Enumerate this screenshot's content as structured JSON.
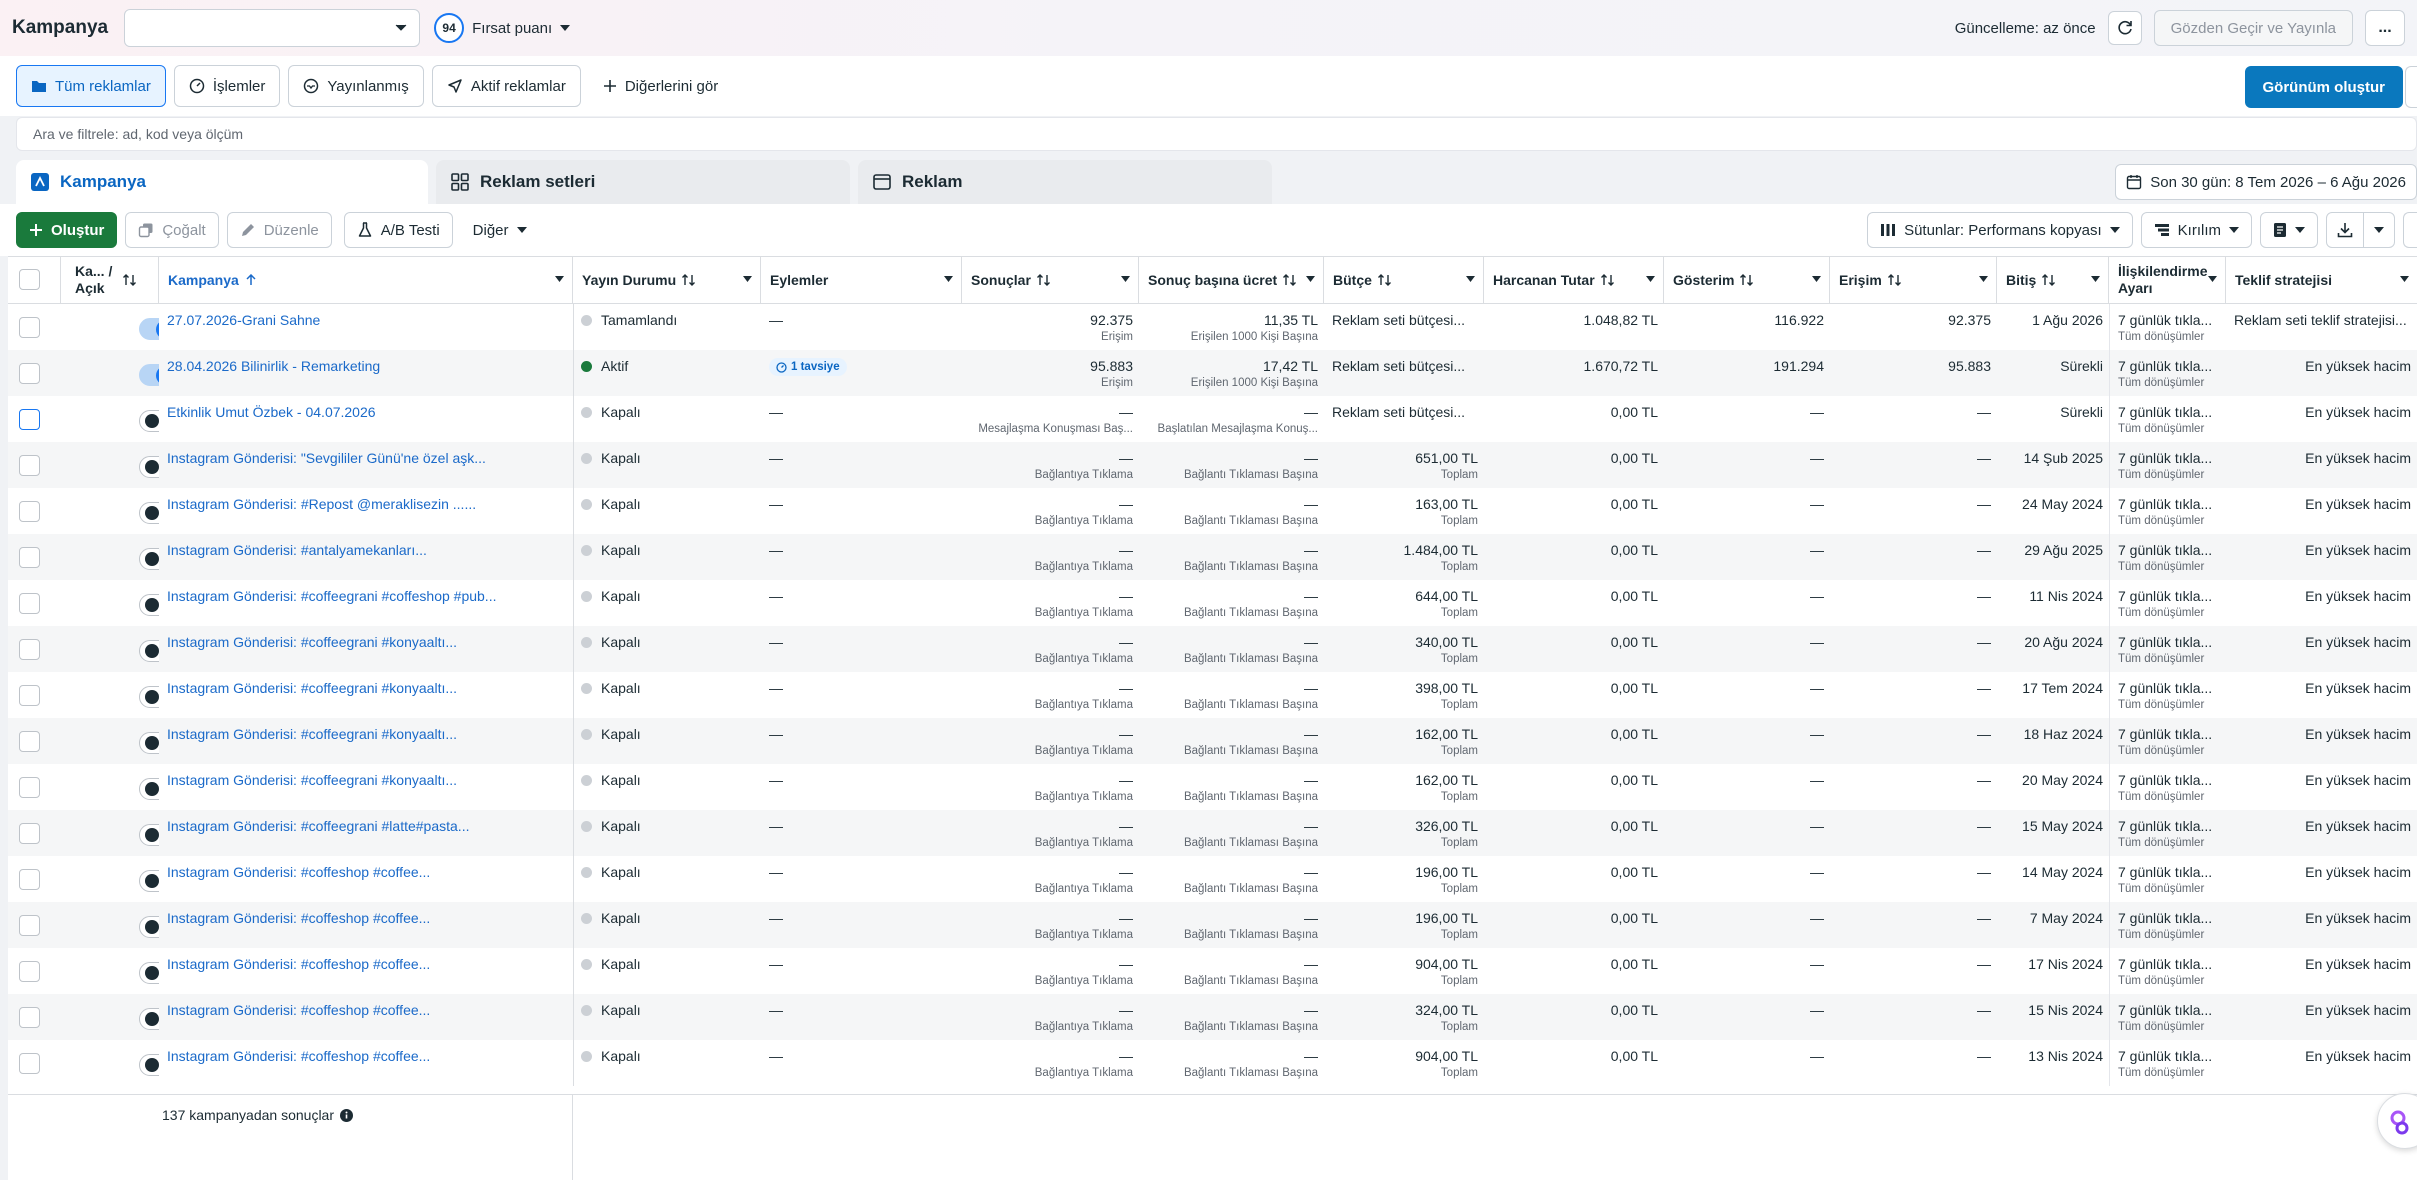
{
  "header": {
    "title": "Kampanya",
    "campaign_select_value": "",
    "score_value": "94",
    "score_label": "Fırsat puanı",
    "updated_text": "Güncelleme: az önce",
    "review_publish_label": "Gözden Geçir ve Yayınla",
    "more_label": "..."
  },
  "views": {
    "items": [
      "Tüm reklamlar",
      "İşlemler",
      "Yayınlanmış",
      "Aktif reklamlar",
      "Diğerlerini gör"
    ],
    "create_view_label": "Görünüm oluştur"
  },
  "search": {
    "placeholder": "Ara ve filtrele: ad, kod veya ölçüm"
  },
  "level_tabs": {
    "campaign": "Kampanya",
    "adsets": "Reklam setleri",
    "ads": "Reklam",
    "date_range": "Son 30 gün: 8 Tem 2026 – 6 Ağu 2026"
  },
  "toolbar": {
    "create": "Oluştur",
    "duplicate": "Çoğalt",
    "edit": "Düzenle",
    "ab_test": "A/B Testi",
    "other": "Diğer",
    "columns": "Sütunlar: Performans kopyası",
    "breakdown": "Kırılım"
  },
  "table": {
    "headers": {
      "toggle": "Ka... / Açık",
      "campaign": "Kampanya",
      "delivery": "Yayın Durumu",
      "actions": "Eylemler",
      "results": "Sonuçlar",
      "cost_per_result": "Sonuç başına ücret",
      "budget": "Bütçe",
      "amount_spent": "Harcanan Tutar",
      "impressions": "Gösterim",
      "reach": "Erişim",
      "ends": "Bitiş",
      "attribution": "İlişkilendirme Ayarı",
      "bid_strategy": "Teklif stratejisi"
    },
    "rows": [
      {
        "on": true,
        "name": "27.07.2026-Grani Sahne",
        "status": "Tamamlandı",
        "status_type": "off",
        "actions": "—",
        "badge": "",
        "results": "92.375",
        "results_sub": "Erişim",
        "cpr": "11,35 TL",
        "cpr_sub": "Erişilen 1000 Kişi Başına",
        "budget": "Reklam seti bütçesi...",
        "budget_sub": "",
        "spent": "1.048,82 TL",
        "impressions": "116.922",
        "reach": "92.375",
        "ends": "1 Ağu 2026",
        "attribution": "7 günlük tıkla...",
        "attribution_sub": "Tüm dönüşümler",
        "bid": "Reklam seti teklif stratejisi..."
      },
      {
        "on": true,
        "name": "28.04.2026 Bilinirlik - Remarketing",
        "status": "Aktif",
        "status_type": "active",
        "actions": "",
        "badge": "1 tavsiye",
        "results": "95.883",
        "results_sub": "Erişim",
        "cpr": "17,42 TL",
        "cpr_sub": "Erişilen 1000 Kişi Başına",
        "budget": "Reklam seti bütçesi...",
        "budget_sub": "",
        "spent": "1.670,72 TL",
        "impressions": "191.294",
        "reach": "95.883",
        "ends": "Sürekli",
        "attribution": "7 günlük tıkla...",
        "attribution_sub": "Tüm dönüşümler",
        "bid": "En yüksek hacim"
      },
      {
        "on": false,
        "name": "Etkinlik Umut Özbek - 04.07.2026",
        "status": "Kapalı",
        "status_type": "off",
        "actions": "—",
        "badge": "",
        "results": "—",
        "results_sub": "Mesajlaşma Konuşması Baş...",
        "cpr": "—",
        "cpr_sub": "Başlatılan Mesajlaşma Konuş...",
        "budget": "Reklam seti bütçesi...",
        "budget_sub": "",
        "spent": "0,00 TL",
        "impressions": "—",
        "reach": "—",
        "ends": "Sürekli",
        "attribution": "7 günlük tıkla...",
        "attribution_sub": "Tüm dönüşümler",
        "bid": "En yüksek hacim"
      },
      {
        "on": false,
        "name": "Instagram Gönderisi: \"Sevgililer Günü'ne özel aşk...",
        "status": "Kapalı",
        "status_type": "off",
        "actions": "—",
        "badge": "",
        "results": "—",
        "results_sub": "Bağlantıya Tıklama",
        "cpr": "—",
        "cpr_sub": "Bağlantı Tıklaması Başına",
        "budget": "651,00 TL",
        "budget_sub": "Toplam",
        "spent": "0,00 TL",
        "impressions": "—",
        "reach": "—",
        "ends": "14 Şub 2025",
        "attribution": "7 günlük tıkla...",
        "attribution_sub": "Tüm dönüşümler",
        "bid": "En yüksek hacim"
      },
      {
        "on": false,
        "name": "Instagram Gönderisi: #Repost @meraklisezin ......",
        "status": "Kapalı",
        "status_type": "off",
        "actions": "—",
        "badge": "",
        "results": "—",
        "results_sub": "Bağlantıya Tıklama",
        "cpr": "—",
        "cpr_sub": "Bağlantı Tıklaması Başına",
        "budget": "163,00 TL",
        "budget_sub": "Toplam",
        "spent": "0,00 TL",
        "impressions": "—",
        "reach": "—",
        "ends": "24 May 2024",
        "attribution": "7 günlük tıkla...",
        "attribution_sub": "Tüm dönüşümler",
        "bid": "En yüksek hacim"
      },
      {
        "on": false,
        "name": "Instagram Gönderisi: #antalyamekanları...",
        "status": "Kapalı",
        "status_type": "off",
        "actions": "—",
        "badge": "",
        "results": "—",
        "results_sub": "Bağlantıya Tıklama",
        "cpr": "—",
        "cpr_sub": "Bağlantı Tıklaması Başına",
        "budget": "1.484,00 TL",
        "budget_sub": "Toplam",
        "spent": "0,00 TL",
        "impressions": "—",
        "reach": "—",
        "ends": "29 Ağu 2025",
        "attribution": "7 günlük tıkla...",
        "attribution_sub": "Tüm dönüşümler",
        "bid": "En yüksek hacim"
      },
      {
        "on": false,
        "name": "Instagram Gönderisi: #coffeegrani #coffeshop #pub...",
        "status": "Kapalı",
        "status_type": "off",
        "actions": "—",
        "badge": "",
        "results": "—",
        "results_sub": "Bağlantıya Tıklama",
        "cpr": "—",
        "cpr_sub": "Bağlantı Tıklaması Başına",
        "budget": "644,00 TL",
        "budget_sub": "Toplam",
        "spent": "0,00 TL",
        "impressions": "—",
        "reach": "—",
        "ends": "11 Nis 2024",
        "attribution": "7 günlük tıkla...",
        "attribution_sub": "Tüm dönüşümler",
        "bid": "En yüksek hacim"
      },
      {
        "on": false,
        "name": "Instagram Gönderisi: #coffeegrani #konyaaltı...",
        "status": "Kapalı",
        "status_type": "off",
        "actions": "—",
        "badge": "",
        "results": "—",
        "results_sub": "Bağlantıya Tıklama",
        "cpr": "—",
        "cpr_sub": "Bağlantı Tıklaması Başına",
        "budget": "340,00 TL",
        "budget_sub": "Toplam",
        "spent": "0,00 TL",
        "impressions": "—",
        "reach": "—",
        "ends": "20 Ağu 2024",
        "attribution": "7 günlük tıkla...",
        "attribution_sub": "Tüm dönüşümler",
        "bid": "En yüksek hacim"
      },
      {
        "on": false,
        "name": "Instagram Gönderisi: #coffeegrani #konyaaltı...",
        "status": "Kapalı",
        "status_type": "off",
        "actions": "—",
        "badge": "",
        "results": "—",
        "results_sub": "Bağlantıya Tıklama",
        "cpr": "—",
        "cpr_sub": "Bağlantı Tıklaması Başına",
        "budget": "398,00 TL",
        "budget_sub": "Toplam",
        "spent": "0,00 TL",
        "impressions": "—",
        "reach": "—",
        "ends": "17 Tem 2024",
        "attribution": "7 günlük tıkla...",
        "attribution_sub": "Tüm dönüşümler",
        "bid": "En yüksek hacim"
      },
      {
        "on": false,
        "name": "Instagram Gönderisi: #coffeegrani #konyaaltı...",
        "status": "Kapalı",
        "status_type": "off",
        "actions": "—",
        "badge": "",
        "results": "—",
        "results_sub": "Bağlantıya Tıklama",
        "cpr": "—",
        "cpr_sub": "Bağlantı Tıklaması Başına",
        "budget": "162,00 TL",
        "budget_sub": "Toplam",
        "spent": "0,00 TL",
        "impressions": "—",
        "reach": "—",
        "ends": "18 Haz 2024",
        "attribution": "7 günlük tıkla...",
        "attribution_sub": "Tüm dönüşümler",
        "bid": "En yüksek hacim"
      },
      {
        "on": false,
        "name": "Instagram Gönderisi: #coffeegrani #konyaaltı...",
        "status": "Kapalı",
        "status_type": "off",
        "actions": "—",
        "badge": "",
        "results": "—",
        "results_sub": "Bağlantıya Tıklama",
        "cpr": "—",
        "cpr_sub": "Bağlantı Tıklaması Başına",
        "budget": "162,00 TL",
        "budget_sub": "Toplam",
        "spent": "0,00 TL",
        "impressions": "—",
        "reach": "—",
        "ends": "20 May 2024",
        "attribution": "7 günlük tıkla...",
        "attribution_sub": "Tüm dönüşümler",
        "bid": "En yüksek hacim"
      },
      {
        "on": false,
        "name": "Instagram Gönderisi: #coffeegrani #latte#pasta...",
        "status": "Kapalı",
        "status_type": "off",
        "actions": "—",
        "badge": "",
        "results": "—",
        "results_sub": "Bağlantıya Tıklama",
        "cpr": "—",
        "cpr_sub": "Bağlantı Tıklaması Başına",
        "budget": "326,00 TL",
        "budget_sub": "Toplam",
        "spent": "0,00 TL",
        "impressions": "—",
        "reach": "—",
        "ends": "15 May 2024",
        "attribution": "7 günlük tıkla...",
        "attribution_sub": "Tüm dönüşümler",
        "bid": "En yüksek hacim"
      },
      {
        "on": false,
        "name": "Instagram Gönderisi: #coffeshop #coffee...",
        "status": "Kapalı",
        "status_type": "off",
        "actions": "—",
        "badge": "",
        "results": "—",
        "results_sub": "Bağlantıya Tıklama",
        "cpr": "—",
        "cpr_sub": "Bağlantı Tıklaması Başına",
        "budget": "196,00 TL",
        "budget_sub": "Toplam",
        "spent": "0,00 TL",
        "impressions": "—",
        "reach": "—",
        "ends": "14 May 2024",
        "attribution": "7 günlük tıkla...",
        "attribution_sub": "Tüm dönüşümler",
        "bid": "En yüksek hacim"
      },
      {
        "on": false,
        "name": "Instagram Gönderisi: #coffeshop #coffee...",
        "status": "Kapalı",
        "status_type": "off",
        "actions": "—",
        "badge": "",
        "results": "—",
        "results_sub": "Bağlantıya Tıklama",
        "cpr": "—",
        "cpr_sub": "Bağlantı Tıklaması Başına",
        "budget": "196,00 TL",
        "budget_sub": "Toplam",
        "spent": "0,00 TL",
        "impressions": "—",
        "reach": "—",
        "ends": "7 May 2024",
        "attribution": "7 günlük tıkla...",
        "attribution_sub": "Tüm dönüşümler",
        "bid": "En yüksek hacim"
      },
      {
        "on": false,
        "name": "Instagram Gönderisi: #coffeshop #coffee...",
        "status": "Kapalı",
        "status_type": "off",
        "actions": "—",
        "badge": "",
        "results": "—",
        "results_sub": "Bağlantıya Tıklama",
        "cpr": "—",
        "cpr_sub": "Bağlantı Tıklaması Başına",
        "budget": "904,00 TL",
        "budget_sub": "Toplam",
        "spent": "0,00 TL",
        "impressions": "—",
        "reach": "—",
        "ends": "17 Nis 2024",
        "attribution": "7 günlük tıkla...",
        "attribution_sub": "Tüm dönüşümler",
        "bid": "En yüksek hacim"
      },
      {
        "on": false,
        "name": "Instagram Gönderisi: #coffeshop #coffee...",
        "status": "Kapalı",
        "status_type": "off",
        "actions": "—",
        "badge": "",
        "results": "—",
        "results_sub": "Bağlantıya Tıklama",
        "cpr": "—",
        "cpr_sub": "Bağlantı Tıklaması Başına",
        "budget": "324,00 TL",
        "budget_sub": "Toplam",
        "spent": "0,00 TL",
        "impressions": "—",
        "reach": "—",
        "ends": "15 Nis 2024",
        "attribution": "7 günlük tıkla...",
        "attribution_sub": "Tüm dönüşümler",
        "bid": "En yüksek hacim"
      },
      {
        "on": false,
        "name": "Instagram Gönderisi: #coffeshop #coffee...",
        "status": "Kapalı",
        "status_type": "off",
        "actions": "—",
        "badge": "",
        "results": "—",
        "results_sub": "Bağlantıya Tıklama",
        "cpr": "—",
        "cpr_sub": "Bağlantı Tıklaması Başına",
        "budget": "904,00 TL",
        "budget_sub": "Toplam",
        "spent": "0,00 TL",
        "impressions": "—",
        "reach": "—",
        "ends": "13 Nis 2024",
        "attribution": "7 günlük tıkla...",
        "attribution_sub": "Tüm dönüşümler",
        "bid": "En yüksek hacim"
      }
    ],
    "footer_text": "137 kampanyadan sonuçlar"
  }
}
